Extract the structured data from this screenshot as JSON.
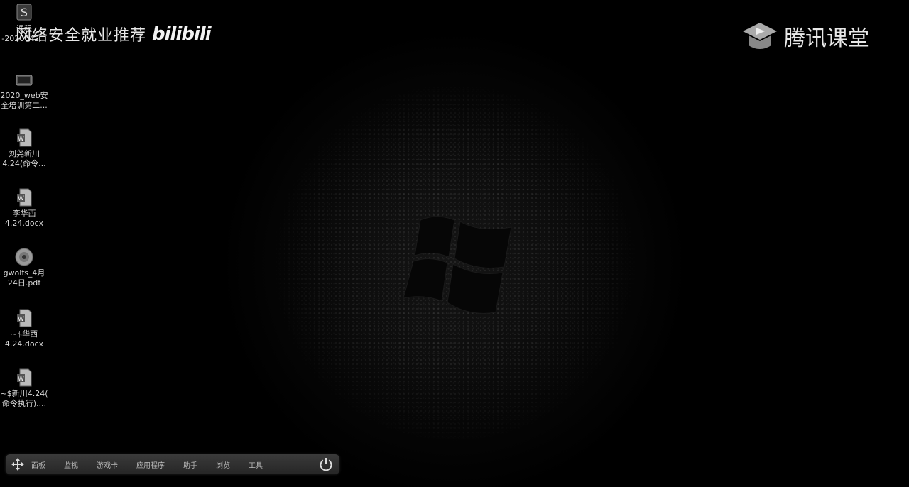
{
  "watermarks": {
    "left_text": "网络安全就业推荐",
    "left_brand": "bilibili",
    "right_text": "腾讯课堂"
  },
  "desktop_icons": [
    {
      "line1": "课程",
      "line2": "-2020042...",
      "icon": "app-shortcut-icon"
    },
    {
      "line1": "2020_web安",
      "line2": "全培训第二...",
      "icon": "video-file-icon"
    },
    {
      "line1": "刘尧新川",
      "line2": "4.24(命令...",
      "icon": "word-document-icon"
    },
    {
      "line1": "李华西",
      "line2": "4.24.docx",
      "icon": "word-document-icon"
    },
    {
      "line1": "gwolfs_4月",
      "line2": "24日.pdf",
      "icon": "pdf-disc-icon"
    },
    {
      "line1": "~$华西",
      "line2": "4.24.docx",
      "icon": "word-document-icon"
    },
    {
      "line1": "~$新川4.24(",
      "line2": "命令执行)....",
      "icon": "word-document-icon"
    }
  ],
  "taskbar": {
    "items": [
      "面板",
      "监视",
      "游戏卡",
      "应用程序",
      "助手",
      "浏览",
      "工具"
    ]
  },
  "colors": {
    "background": "#000000",
    "text": "#d8d8d8",
    "taskbar": "#2e2e2e"
  }
}
